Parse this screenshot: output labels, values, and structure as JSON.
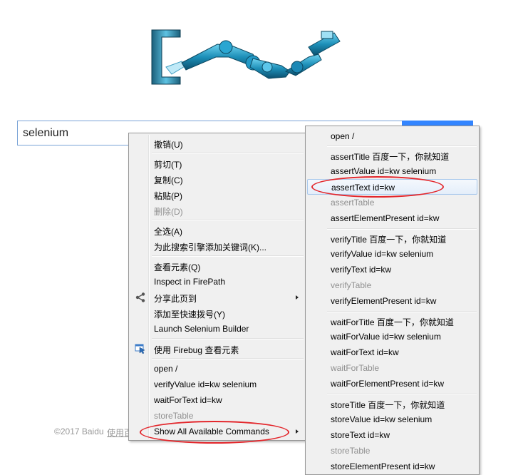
{
  "search": {
    "value": "selenium"
  },
  "footer": {
    "copyright": "©2017 Baidu",
    "link": "使用百度前必读"
  },
  "context_menu": {
    "items": [
      {
        "label": "撤销(U)",
        "disabled": false
      },
      {
        "label": "剪切(T)",
        "disabled": false
      },
      {
        "label": "复制(C)",
        "disabled": false
      },
      {
        "label": "粘贴(P)",
        "disabled": false
      },
      {
        "label": "删除(D)",
        "disabled": true
      },
      {
        "label": "全选(A)",
        "disabled": false
      },
      {
        "label": "为此搜索引擎添加关键词(K)...",
        "disabled": false
      },
      {
        "label": "查看元素(Q)",
        "disabled": false
      },
      {
        "label": "Inspect in FirePath",
        "disabled": false
      },
      {
        "label": "分享此页到",
        "disabled": false,
        "icon": "share-icon",
        "submenu": true
      },
      {
        "label": "添加至快速拨号(Y)",
        "disabled": false
      },
      {
        "label": "Launch Selenium Builder",
        "disabled": false
      },
      {
        "label": "使用 Firebug 查看元素",
        "disabled": false,
        "icon": "firebug-icon"
      },
      {
        "label": "open /",
        "disabled": false
      },
      {
        "label": "verifyValue id=kw selenium",
        "disabled": false
      },
      {
        "label": "waitForText id=kw",
        "disabled": false
      },
      {
        "label": "storeTable",
        "disabled": true
      },
      {
        "label": "Show All Available Commands",
        "disabled": false,
        "submenu": true
      }
    ]
  },
  "submenu": {
    "items": [
      {
        "label": "open /",
        "disabled": false
      },
      {
        "label": "assertTitle 百度一下，你就知道",
        "disabled": false
      },
      {
        "label": "assertValue id=kw selenium",
        "disabled": false
      },
      {
        "label": "assertText id=kw",
        "disabled": false,
        "highlighted": true
      },
      {
        "label": "assertTable",
        "disabled": true
      },
      {
        "label": "assertElementPresent id=kw",
        "disabled": false
      },
      {
        "label": "verifyTitle 百度一下，你就知道",
        "disabled": false
      },
      {
        "label": "verifyValue id=kw selenium",
        "disabled": false
      },
      {
        "label": "verifyText id=kw",
        "disabled": false
      },
      {
        "label": "verifyTable",
        "disabled": true
      },
      {
        "label": "verifyElementPresent id=kw",
        "disabled": false
      },
      {
        "label": "waitForTitle 百度一下，你就知道",
        "disabled": false
      },
      {
        "label": "waitForValue id=kw selenium",
        "disabled": false
      },
      {
        "label": "waitForText id=kw",
        "disabled": false
      },
      {
        "label": "waitForTable",
        "disabled": true
      },
      {
        "label": "waitForElementPresent id=kw",
        "disabled": false
      },
      {
        "label": "storeTitle 百度一下，你就知道",
        "disabled": false
      },
      {
        "label": "storeValue id=kw selenium",
        "disabled": false
      },
      {
        "label": "storeText id=kw",
        "disabled": false
      },
      {
        "label": "storeTable",
        "disabled": true
      },
      {
        "label": "storeElementPresent id=kw",
        "disabled": false
      }
    ]
  },
  "colors": {
    "accent": "#3385ff",
    "annotation": "#e3262b",
    "menu_bg": "#f0f0f0"
  }
}
